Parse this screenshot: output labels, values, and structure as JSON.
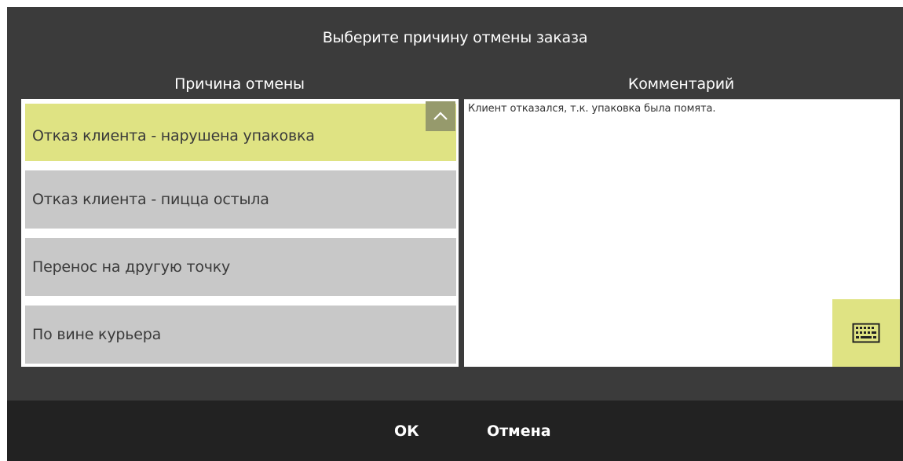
{
  "dialog": {
    "title": "Выберите причину отмены заказа",
    "reason_header": "Причина отмены",
    "comment_header": "Комментарий"
  },
  "reasons": [
    {
      "label": "Отказ клиента - нарушена упаковка",
      "selected": true
    },
    {
      "label": "Отказ клиента - пицца остыла",
      "selected": false
    },
    {
      "label": "Перенос на другую точку",
      "selected": false
    },
    {
      "label": "По вине курьера",
      "selected": false
    }
  ],
  "comment": {
    "value": "Клиент отказался, т.к. упаковка была помята."
  },
  "icons": {
    "scroll_up": "chevron-up-icon",
    "keyboard": "keyboard-icon"
  },
  "footer": {
    "ok_label": "ОК",
    "cancel_label": "Отмена"
  },
  "colors": {
    "selected_bg": "#dfe383",
    "item_bg": "#c8c8c8",
    "dialog_bg": "#3b3b3b",
    "footer_bg": "#222222"
  }
}
